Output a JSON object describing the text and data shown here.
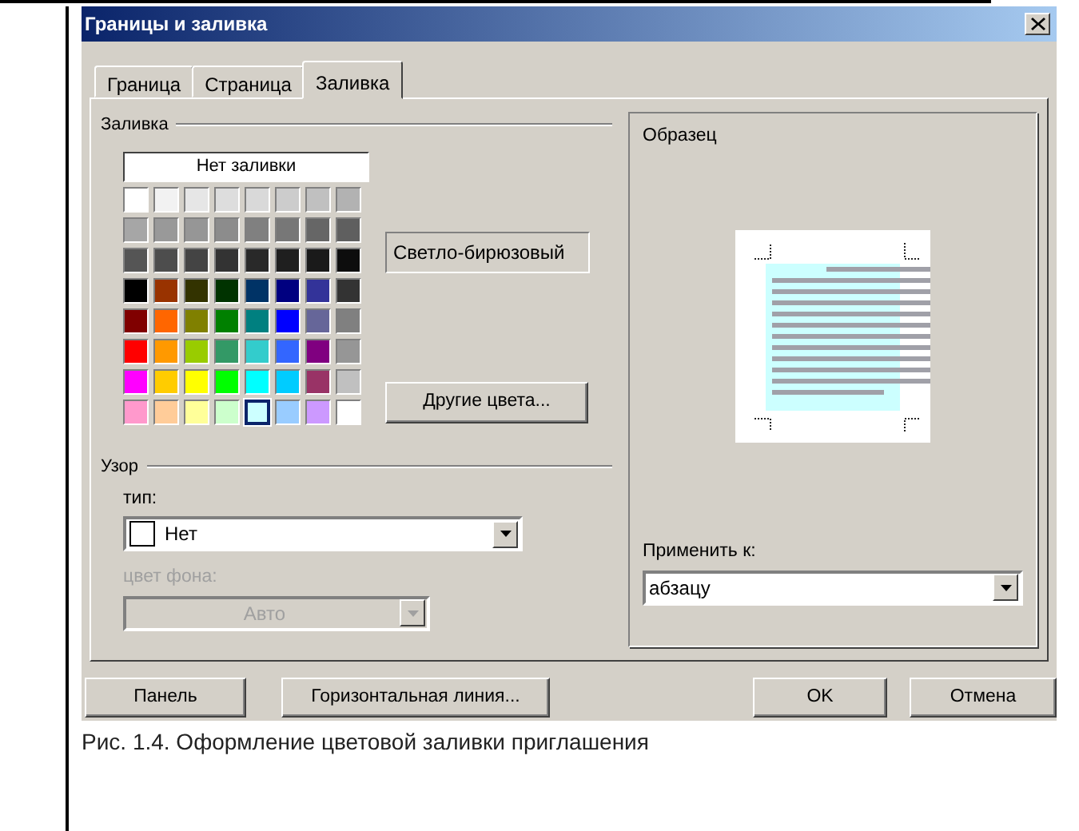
{
  "window": {
    "title": "Границы и заливка"
  },
  "tabs": [
    {
      "label": "Граница",
      "selected": false
    },
    {
      "label": "Страница",
      "selected": false
    },
    {
      "label": "Заливка",
      "selected": true
    }
  ],
  "fill": {
    "label": "Заливка",
    "no_fill": "Нет заливки",
    "swatches": [
      [
        {
          "color": "#ffffff",
          "selected": false
        },
        {
          "color": "#f2f2f2",
          "selected": false
        },
        {
          "color": "#e6e6e6",
          "selected": false
        },
        {
          "color": "#dddddd",
          "selected": false
        },
        {
          "color": "#d9d9d9",
          "selected": false
        },
        {
          "color": "#cccccc",
          "selected": false
        },
        {
          "color": "#c0c0c0",
          "selected": false
        },
        {
          "color": "#b2b2b2",
          "selected": false
        }
      ],
      [
        {
          "color": "#a6a6a6",
          "selected": false
        },
        {
          "color": "#999999",
          "selected": false
        },
        {
          "color": "#969696",
          "selected": false
        },
        {
          "color": "#8c8c8c",
          "selected": false
        },
        {
          "color": "#808080",
          "selected": false
        },
        {
          "color": "#777777",
          "selected": false
        },
        {
          "color": "#666666",
          "selected": false
        },
        {
          "color": "#5f5f5f",
          "selected": false
        }
      ],
      [
        {
          "color": "#555555",
          "selected": false
        },
        {
          "color": "#4d4d4d",
          "selected": false
        },
        {
          "color": "#444444",
          "selected": false
        },
        {
          "color": "#333333",
          "selected": false
        },
        {
          "color": "#292929",
          "selected": false
        },
        {
          "color": "#1f1f1f",
          "selected": false
        },
        {
          "color": "#1a1a1a",
          "selected": false
        },
        {
          "color": "#0d0d0d",
          "selected": false
        }
      ],
      [
        {
          "color": "#000000",
          "selected": false
        },
        {
          "color": "#993300",
          "selected": false
        },
        {
          "color": "#333300",
          "selected": false
        },
        {
          "color": "#003300",
          "selected": false
        },
        {
          "color": "#003366",
          "selected": false
        },
        {
          "color": "#000080",
          "selected": false
        },
        {
          "color": "#333399",
          "selected": false
        },
        {
          "color": "#333333",
          "selected": false
        }
      ],
      [
        {
          "color": "#800000",
          "selected": false
        },
        {
          "color": "#ff6600",
          "selected": false
        },
        {
          "color": "#808000",
          "selected": false
        },
        {
          "color": "#008000",
          "selected": false
        },
        {
          "color": "#008080",
          "selected": false
        },
        {
          "color": "#0000ff",
          "selected": false
        },
        {
          "color": "#666699",
          "selected": false
        },
        {
          "color": "#808080",
          "selected": false
        }
      ],
      [
        {
          "color": "#ff0000",
          "selected": false
        },
        {
          "color": "#ff9900",
          "selected": false
        },
        {
          "color": "#99cc00",
          "selected": false
        },
        {
          "color": "#339966",
          "selected": false
        },
        {
          "color": "#33cccc",
          "selected": false
        },
        {
          "color": "#3366ff",
          "selected": false
        },
        {
          "color": "#800080",
          "selected": false
        },
        {
          "color": "#969696",
          "selected": false
        }
      ],
      [
        {
          "color": "#ff00ff",
          "selected": false
        },
        {
          "color": "#ffcc00",
          "selected": false
        },
        {
          "color": "#ffff00",
          "selected": false
        },
        {
          "color": "#00ff00",
          "selected": false
        },
        {
          "color": "#00ffff",
          "selected": false
        },
        {
          "color": "#00ccff",
          "selected": false
        },
        {
          "color": "#993366",
          "selected": false
        },
        {
          "color": "#c0c0c0",
          "selected": false
        }
      ],
      [
        {
          "color": "#ff99cc",
          "selected": false
        },
        {
          "color": "#ffcc99",
          "selected": false
        },
        {
          "color": "#ffff99",
          "selected": false
        },
        {
          "color": "#ccffcc",
          "selected": false
        },
        {
          "color": "#ccffff",
          "selected": true
        },
        {
          "color": "#99ccff",
          "selected": false
        },
        {
          "color": "#cc99ff",
          "selected": false
        },
        {
          "color": "#ffffff",
          "selected": false
        }
      ]
    ],
    "color_name": "Светло-бирюзовый",
    "more_colors": "Другие цвета..."
  },
  "pattern": {
    "label": "Узор",
    "type_label": "тип:",
    "type_value": "Нет",
    "background_label": "цвет фона:",
    "background_value": "Авто",
    "background_disabled": true
  },
  "preview": {
    "label": "Образец",
    "apply_label": "Применить к:",
    "apply_value": "абзацу"
  },
  "left_buttons": [
    "Панель",
    "Горизонтальная линия..."
  ],
  "right_buttons": [
    "OK",
    "Отмена"
  ],
  "caption": "Рис. 1.4. Оформление цветовой заливки приглашения"
}
